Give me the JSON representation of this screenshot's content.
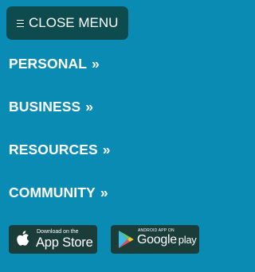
{
  "menu": {
    "close_label": "CLOSE MENU",
    "close_icon": "hamburger-icon"
  },
  "nav": {
    "items": [
      {
        "label": "PERSONAL",
        "arrow": "»"
      },
      {
        "label": "BUSINESS",
        "arrow": "»"
      },
      {
        "label": "RESOURCES",
        "arrow": "»"
      },
      {
        "label": "COMMUNITY",
        "arrow": "»"
      }
    ]
  },
  "badges": {
    "apple": {
      "small": "Download on the",
      "big": "App Store",
      "icon": "apple-icon"
    },
    "google": {
      "small": "ANDROID APP ON",
      "big_google": "Google",
      "big_play": "play",
      "icon": "google-play-icon"
    }
  },
  "colors": {
    "background": "#0a8bb4",
    "close_button": "#0d4b4f",
    "badge": "#1b3d3a",
    "text": "#ffffff"
  }
}
